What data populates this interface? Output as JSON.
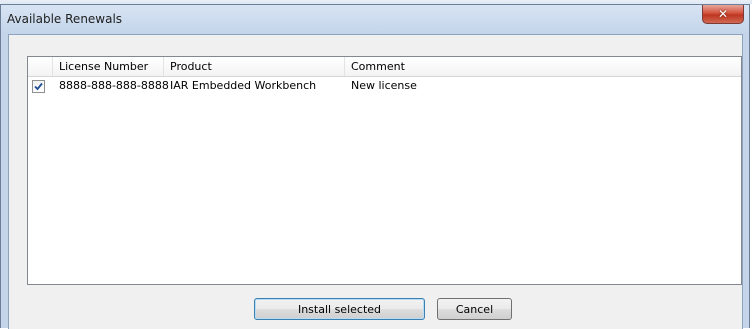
{
  "window": {
    "title": "Available Renewals"
  },
  "list": {
    "columns": [
      "License Number",
      "Product",
      "Comment"
    ],
    "rows": [
      {
        "checked": true,
        "license_number": "8888-888-888-8888",
        "product": "IAR Embedded Workbench",
        "comment": "New license"
      }
    ]
  },
  "buttons": {
    "install_selected": "Install selected",
    "cancel": "Cancel"
  },
  "icons": {
    "close": "close-icon",
    "check": "checkmark-icon"
  },
  "colors": {
    "close_button": "#c7432d",
    "checkmark": "#1e4e96",
    "default_button_border": "#3c7fb1"
  }
}
